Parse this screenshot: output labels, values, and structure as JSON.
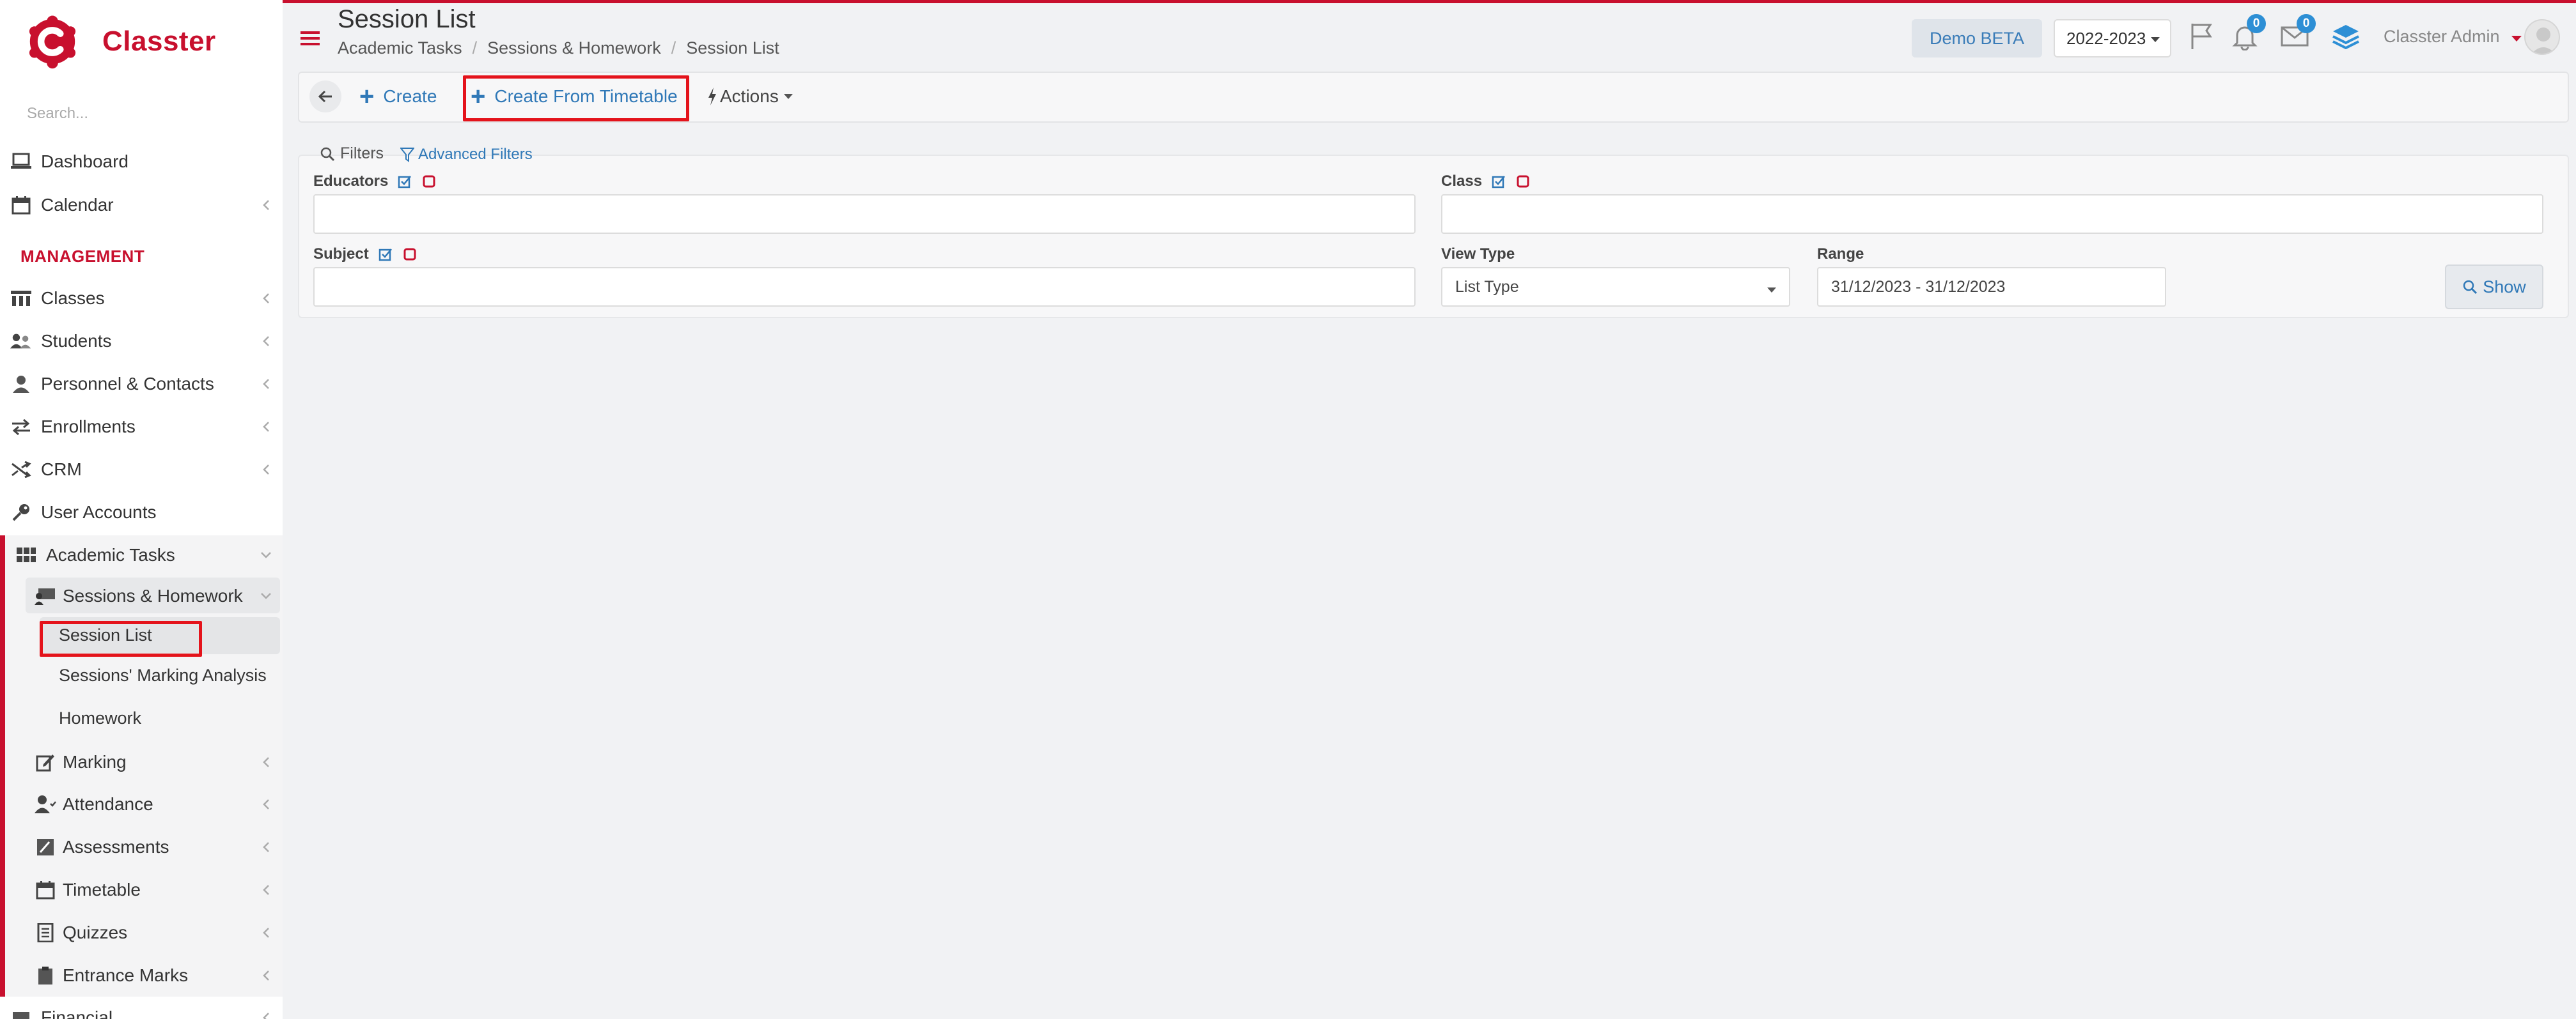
{
  "app": {
    "brand": "Classter",
    "brand_color": "#c8102e",
    "accent_color": "#2f78b7"
  },
  "sidebar": {
    "search_placeholder": "Search...",
    "section_management": "MANAGEMENT",
    "items": {
      "dashboard": "Dashboard",
      "calendar": "Calendar",
      "classes": "Classes",
      "students": "Students",
      "personnel": "Personnel & Contacts",
      "enrollments": "Enrollments",
      "crm": "CRM",
      "user_accounts": "User Accounts",
      "academic_tasks": "Academic Tasks",
      "sessions_homework": "Sessions & Homework",
      "session_list": "Session List",
      "marking_analysis": "Sessions' Marking Analysis",
      "homework": "Homework",
      "marking": "Marking",
      "attendance": "Attendance",
      "assessments": "Assessments",
      "timetable": "Timetable",
      "quizzes": "Quizzes",
      "entrance_marks": "Entrance Marks",
      "financial": "Financial"
    }
  },
  "header": {
    "title": "Session List",
    "breadcrumb": [
      "Academic Tasks",
      "Sessions & Homework",
      "Session List"
    ],
    "breadcrumb_sep": "/",
    "demo_label": "Demo BETA",
    "year": "2022-2023",
    "notifications_count": "0",
    "messages_count": "0",
    "user_name": "Classter Admin"
  },
  "toolbar": {
    "create_label": "Create",
    "create_from_timetable_label": "Create From Timetable",
    "actions_label": "Actions"
  },
  "filters": {
    "tab_label": "Filters",
    "advanced_label": "Advanced Filters",
    "educators_label": "Educators",
    "class_label": "Class",
    "subject_label": "Subject",
    "view_type_label": "View Type",
    "view_type_value": "List Type",
    "range_label": "Range",
    "range_value": "31/12/2023 - 31/12/2023",
    "show_label": "Show"
  }
}
